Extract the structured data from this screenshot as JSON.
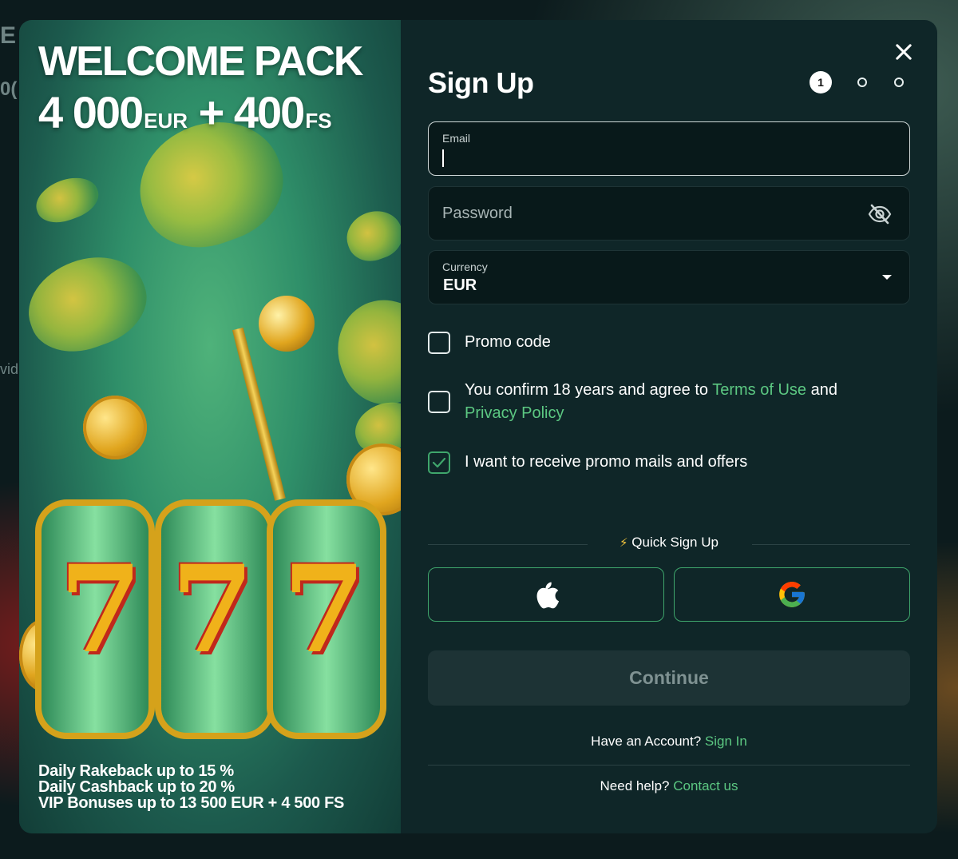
{
  "background": {
    "left_text_1": "E",
    "left_text_2": "0(",
    "left_text_3": "vid"
  },
  "promo": {
    "title": "WELCOME PACK",
    "amount_main": "4 000",
    "amount_unit": "EUR",
    "plus": "+",
    "fs_main": "400",
    "fs_unit": "FS",
    "perks": [
      "Daily Rakeback up to 15 %",
      "Daily Cashback up to 20 %",
      "VIP Bonuses up to 13 500 EUR + 4 500 FS"
    ]
  },
  "form": {
    "title": "Sign Up",
    "steps": {
      "active": "1"
    },
    "email": {
      "label": "Email",
      "value": ""
    },
    "password": {
      "placeholder": "Password"
    },
    "currency": {
      "label": "Currency",
      "value": "EUR"
    },
    "promo_code_label": "Promo code",
    "terms": {
      "prefix": "You confirm 18 years and agree to",
      "terms_link": "Terms of Use",
      "and": "and",
      "privacy_link": "Privacy Policy",
      "checked": false
    },
    "promo_mails": {
      "label": "I want to receive promo mails and offers",
      "checked": true
    },
    "quick_signup": "Quick Sign Up",
    "continue": "Continue",
    "have_account": "Have an Account?",
    "sign_in": "Sign In",
    "need_help": "Need help?",
    "contact_us": "Contact us"
  },
  "colors": {
    "accent": "#5cc882",
    "panel": "#0f2628",
    "field": "#08191a"
  }
}
